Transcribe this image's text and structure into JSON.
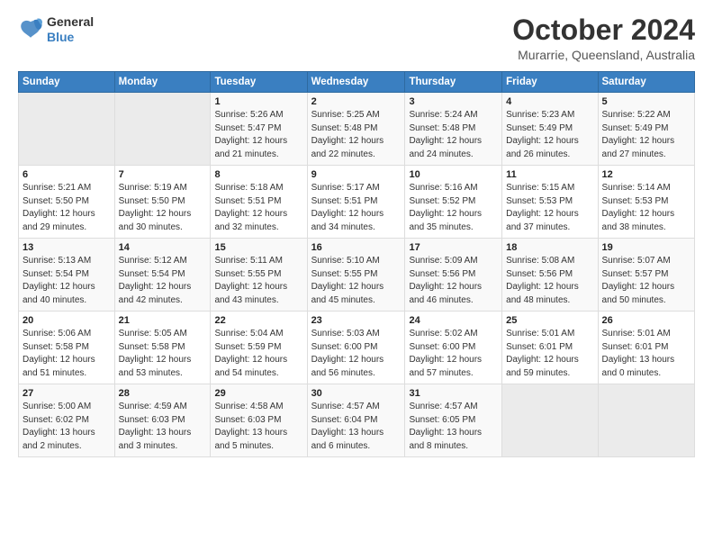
{
  "logo": {
    "line1": "General",
    "line2": "Blue"
  },
  "header": {
    "title": "October 2024",
    "subtitle": "Murarrie, Queensland, Australia"
  },
  "weekdays": [
    "Sunday",
    "Monday",
    "Tuesday",
    "Wednesday",
    "Thursday",
    "Friday",
    "Saturday"
  ],
  "weeks": [
    [
      {
        "day": "",
        "sunrise": "",
        "sunset": "",
        "daylight": ""
      },
      {
        "day": "",
        "sunrise": "",
        "sunset": "",
        "daylight": ""
      },
      {
        "day": "1",
        "sunrise": "Sunrise: 5:26 AM",
        "sunset": "Sunset: 5:47 PM",
        "daylight": "Daylight: 12 hours and 21 minutes."
      },
      {
        "day": "2",
        "sunrise": "Sunrise: 5:25 AM",
        "sunset": "Sunset: 5:48 PM",
        "daylight": "Daylight: 12 hours and 22 minutes."
      },
      {
        "day": "3",
        "sunrise": "Sunrise: 5:24 AM",
        "sunset": "Sunset: 5:48 PM",
        "daylight": "Daylight: 12 hours and 24 minutes."
      },
      {
        "day": "4",
        "sunrise": "Sunrise: 5:23 AM",
        "sunset": "Sunset: 5:49 PM",
        "daylight": "Daylight: 12 hours and 26 minutes."
      },
      {
        "day": "5",
        "sunrise": "Sunrise: 5:22 AM",
        "sunset": "Sunset: 5:49 PM",
        "daylight": "Daylight: 12 hours and 27 minutes."
      }
    ],
    [
      {
        "day": "6",
        "sunrise": "Sunrise: 5:21 AM",
        "sunset": "Sunset: 5:50 PM",
        "daylight": "Daylight: 12 hours and 29 minutes."
      },
      {
        "day": "7",
        "sunrise": "Sunrise: 5:19 AM",
        "sunset": "Sunset: 5:50 PM",
        "daylight": "Daylight: 12 hours and 30 minutes."
      },
      {
        "day": "8",
        "sunrise": "Sunrise: 5:18 AM",
        "sunset": "Sunset: 5:51 PM",
        "daylight": "Daylight: 12 hours and 32 minutes."
      },
      {
        "day": "9",
        "sunrise": "Sunrise: 5:17 AM",
        "sunset": "Sunset: 5:51 PM",
        "daylight": "Daylight: 12 hours and 34 minutes."
      },
      {
        "day": "10",
        "sunrise": "Sunrise: 5:16 AM",
        "sunset": "Sunset: 5:52 PM",
        "daylight": "Daylight: 12 hours and 35 minutes."
      },
      {
        "day": "11",
        "sunrise": "Sunrise: 5:15 AM",
        "sunset": "Sunset: 5:53 PM",
        "daylight": "Daylight: 12 hours and 37 minutes."
      },
      {
        "day": "12",
        "sunrise": "Sunrise: 5:14 AM",
        "sunset": "Sunset: 5:53 PM",
        "daylight": "Daylight: 12 hours and 38 minutes."
      }
    ],
    [
      {
        "day": "13",
        "sunrise": "Sunrise: 5:13 AM",
        "sunset": "Sunset: 5:54 PM",
        "daylight": "Daylight: 12 hours and 40 minutes."
      },
      {
        "day": "14",
        "sunrise": "Sunrise: 5:12 AM",
        "sunset": "Sunset: 5:54 PM",
        "daylight": "Daylight: 12 hours and 42 minutes."
      },
      {
        "day": "15",
        "sunrise": "Sunrise: 5:11 AM",
        "sunset": "Sunset: 5:55 PM",
        "daylight": "Daylight: 12 hours and 43 minutes."
      },
      {
        "day": "16",
        "sunrise": "Sunrise: 5:10 AM",
        "sunset": "Sunset: 5:55 PM",
        "daylight": "Daylight: 12 hours and 45 minutes."
      },
      {
        "day": "17",
        "sunrise": "Sunrise: 5:09 AM",
        "sunset": "Sunset: 5:56 PM",
        "daylight": "Daylight: 12 hours and 46 minutes."
      },
      {
        "day": "18",
        "sunrise": "Sunrise: 5:08 AM",
        "sunset": "Sunset: 5:56 PM",
        "daylight": "Daylight: 12 hours and 48 minutes."
      },
      {
        "day": "19",
        "sunrise": "Sunrise: 5:07 AM",
        "sunset": "Sunset: 5:57 PM",
        "daylight": "Daylight: 12 hours and 50 minutes."
      }
    ],
    [
      {
        "day": "20",
        "sunrise": "Sunrise: 5:06 AM",
        "sunset": "Sunset: 5:58 PM",
        "daylight": "Daylight: 12 hours and 51 minutes."
      },
      {
        "day": "21",
        "sunrise": "Sunrise: 5:05 AM",
        "sunset": "Sunset: 5:58 PM",
        "daylight": "Daylight: 12 hours and 53 minutes."
      },
      {
        "day": "22",
        "sunrise": "Sunrise: 5:04 AM",
        "sunset": "Sunset: 5:59 PM",
        "daylight": "Daylight: 12 hours and 54 minutes."
      },
      {
        "day": "23",
        "sunrise": "Sunrise: 5:03 AM",
        "sunset": "Sunset: 6:00 PM",
        "daylight": "Daylight: 12 hours and 56 minutes."
      },
      {
        "day": "24",
        "sunrise": "Sunrise: 5:02 AM",
        "sunset": "Sunset: 6:00 PM",
        "daylight": "Daylight: 12 hours and 57 minutes."
      },
      {
        "day": "25",
        "sunrise": "Sunrise: 5:01 AM",
        "sunset": "Sunset: 6:01 PM",
        "daylight": "Daylight: 12 hours and 59 minutes."
      },
      {
        "day": "26",
        "sunrise": "Sunrise: 5:01 AM",
        "sunset": "Sunset: 6:01 PM",
        "daylight": "Daylight: 13 hours and 0 minutes."
      }
    ],
    [
      {
        "day": "27",
        "sunrise": "Sunrise: 5:00 AM",
        "sunset": "Sunset: 6:02 PM",
        "daylight": "Daylight: 13 hours and 2 minutes."
      },
      {
        "day": "28",
        "sunrise": "Sunrise: 4:59 AM",
        "sunset": "Sunset: 6:03 PM",
        "daylight": "Daylight: 13 hours and 3 minutes."
      },
      {
        "day": "29",
        "sunrise": "Sunrise: 4:58 AM",
        "sunset": "Sunset: 6:03 PM",
        "daylight": "Daylight: 13 hours and 5 minutes."
      },
      {
        "day": "30",
        "sunrise": "Sunrise: 4:57 AM",
        "sunset": "Sunset: 6:04 PM",
        "daylight": "Daylight: 13 hours and 6 minutes."
      },
      {
        "day": "31",
        "sunrise": "Sunrise: 4:57 AM",
        "sunset": "Sunset: 6:05 PM",
        "daylight": "Daylight: 13 hours and 8 minutes."
      },
      {
        "day": "",
        "sunrise": "",
        "sunset": "",
        "daylight": ""
      },
      {
        "day": "",
        "sunrise": "",
        "sunset": "",
        "daylight": ""
      }
    ]
  ]
}
